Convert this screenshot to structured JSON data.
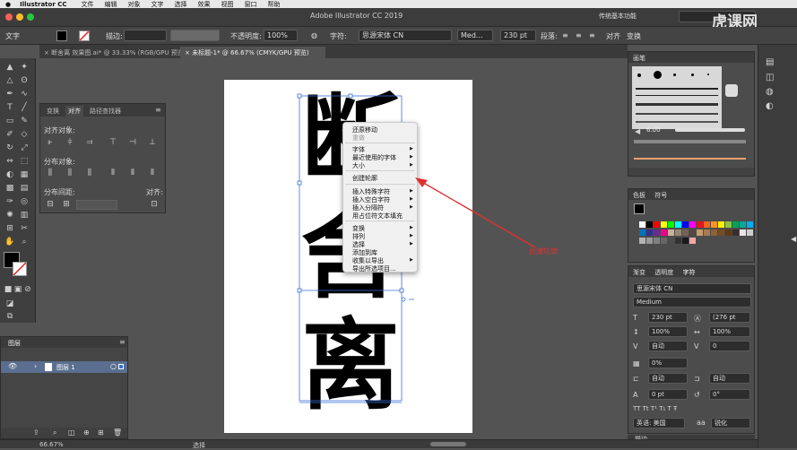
{
  "menubar": {
    "app_name": "Illustrator CC",
    "items": [
      "文件",
      "编辑",
      "对象",
      "文字",
      "选择",
      "效果",
      "视图",
      "窗口",
      "帮助"
    ]
  },
  "titlebar": {
    "title": "Adobe Illustrator CC 2019",
    "workspace": "传统基本功能",
    "watermark": "虎课网"
  },
  "control": {
    "tool_label": "文字",
    "stroke_label": "描边:",
    "opacity_label": "不透明度:",
    "opacity_value": "100%",
    "char_label": "字符:",
    "font_family": "思源宋体 CN",
    "font_style": "Med...",
    "font_size": "230 pt",
    "para_label": "段落:",
    "align_label": "对齐",
    "transform_label": "变换"
  },
  "tabs": [
    {
      "label": "断舍离 效果图.ai* @ 33.33% (RGB/GPU 预览)"
    },
    {
      "label": "未标题-1* @ 66.67% (CMYK/GPU 预览)"
    }
  ],
  "align_panel": {
    "tabs": [
      "变换",
      "对齐",
      "路径查找器"
    ],
    "align_objects": "对齐对象:",
    "distribute_objects": "分布对象:",
    "distribute_spacing": "分布间距:",
    "align_to": "对齐:"
  },
  "layers_panel": {
    "title": "图层",
    "layer_name": "图层 1"
  },
  "artboard": {
    "chars": [
      "断",
      "舍",
      "离"
    ]
  },
  "context_menu": {
    "items": [
      "还原移动",
      "重做",
      "字体",
      "最近使用的字体",
      "大小",
      "创建轮廓",
      "插入特殊字符",
      "插入空白字符",
      "插入分隔符",
      "用占位符文本填充",
      "变换",
      "排列",
      "选择",
      "添加到库",
      "收集以导出",
      "导出所选项目..."
    ]
  },
  "annotation": {
    "text": "创建轮廓",
    "color": "#e03030"
  },
  "brush_panel": {
    "title": "画笔",
    "size": "6.00"
  },
  "swatch_panel": {
    "tabs": [
      "色板",
      "符号"
    ]
  },
  "char_panel": {
    "tabs": [
      "渐变",
      "透明度",
      "字符"
    ],
    "font_family": "思源宋体 CN",
    "font_style": "Medium",
    "font_size": "230 pt",
    "leading": "(276 pt",
    "hscale": "100%",
    "vscale": "100%",
    "kerning": "自动",
    "tracking": "0",
    "tsume": "0%",
    "aki_left": "自动",
    "aki_right": "自动",
    "baseline": "0 pt",
    "rotation": "0°",
    "language": "英语: 美国",
    "antialias": "锐化",
    "collapsed_title": "描边"
  },
  "status": {
    "zoom": "66.67%",
    "tool": "选择"
  },
  "colors": {
    "accent_red": "#e03030",
    "selection_blue": "#3a6fd8"
  }
}
